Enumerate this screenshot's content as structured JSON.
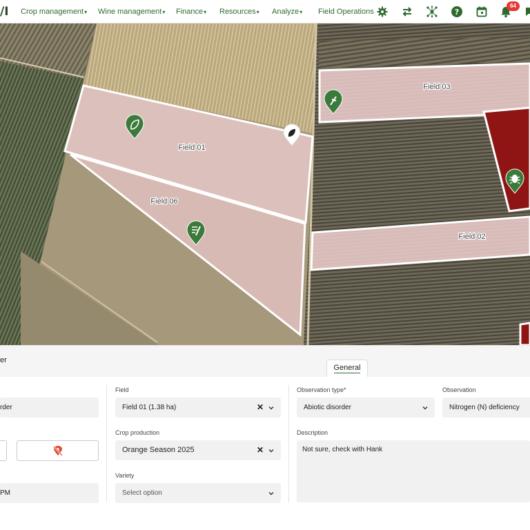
{
  "app": {
    "logo_fragment": "/I"
  },
  "nav": {
    "items": [
      {
        "label": "Crop management",
        "caret": "▾"
      },
      {
        "label": "Wine management",
        "caret": "▾"
      },
      {
        "label": "Finance",
        "caret": "▾"
      },
      {
        "label": "Resources",
        "caret": "▾"
      },
      {
        "label": "Analyze",
        "caret": "▾"
      },
      {
        "label": "Field Operations",
        "caret": ""
      }
    ],
    "icons": [
      "gear-icon",
      "sync-arrows-icon",
      "network-icon",
      "help-icon",
      "calendar-icon",
      "bell-icon",
      "chat-icon"
    ],
    "notification_count": "64"
  },
  "map": {
    "fields": [
      {
        "label": "Field 01"
      },
      {
        "label": "Field 06"
      },
      {
        "label": "Field 03"
      },
      {
        "label": "Field 02"
      }
    ]
  },
  "panel": {
    "title_fragment": "er",
    "tab_general": "General",
    "left": {
      "name_value": "rder",
      "time_value": "PM"
    },
    "field": {
      "label": "Field",
      "value": "Field 01 (1.38 ha)"
    },
    "crop_production": {
      "label": "Crop production",
      "value": "Orange Season 2025"
    },
    "variety": {
      "label": "Variety",
      "placeholder": "Select option"
    },
    "observation_type": {
      "label": "Observation type*",
      "value": "Abiotic disorder"
    },
    "observation": {
      "label": "Observation",
      "value": "Nitrogen (N) deficiency"
    },
    "description": {
      "label": "Description",
      "value": "Not sure, check with Hank"
    }
  },
  "colors": {
    "nav_text": "#2e6a2e",
    "badge": "#e53935",
    "pin_green": "#3c7a3c",
    "field_red": "#8f1515",
    "pin_remove_red": "#e0482f"
  }
}
